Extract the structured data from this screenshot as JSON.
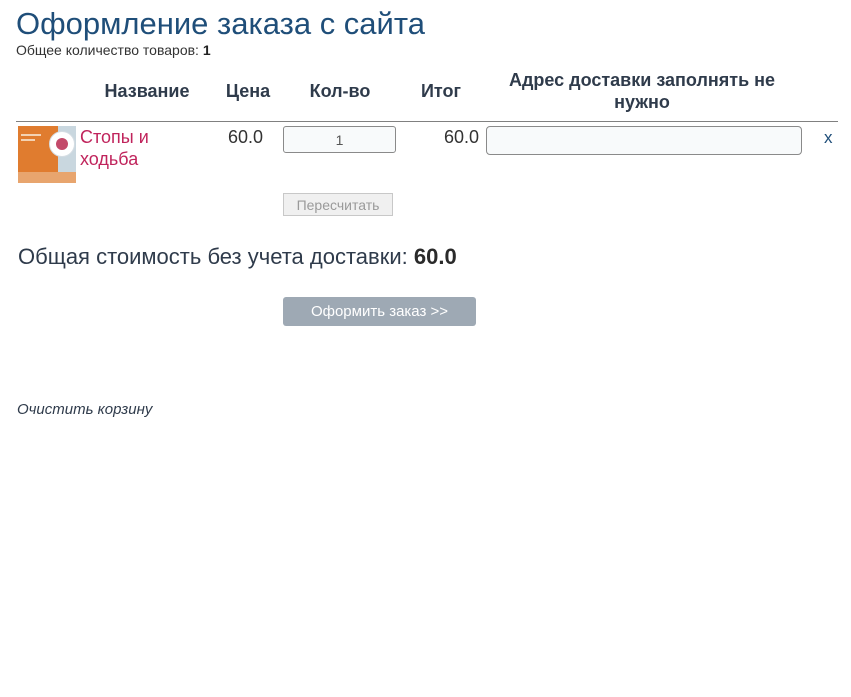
{
  "page": {
    "title": "Оформление заказа с сайта",
    "total_count_label": "Общее количество товаров:",
    "total_count_value": "1"
  },
  "table": {
    "headers": {
      "name": "Название",
      "price": "Цена",
      "quantity": "Кол-во",
      "total": "Итог",
      "address": "Адрес доставки заполнять не нужно"
    },
    "rows": [
      {
        "name": "Стопы и ходьба",
        "price": "60.0",
        "quantity": "1",
        "total": "60.0",
        "address_value": "",
        "remove_label": "x",
        "thumbnail_icon": "book-cover-thumbnail"
      }
    ]
  },
  "actions": {
    "recalc_label": "Пересчитать",
    "checkout_label": "Оформить заказ >>",
    "clear_cart_label": "Очистить корзину"
  },
  "summary": {
    "label": "Общая стоимость без учета доставки:",
    "value": "60.0"
  },
  "colors": {
    "title": "#1f4e79",
    "product_link": "#c0245c",
    "checkout_button": "#9ea9b4"
  }
}
